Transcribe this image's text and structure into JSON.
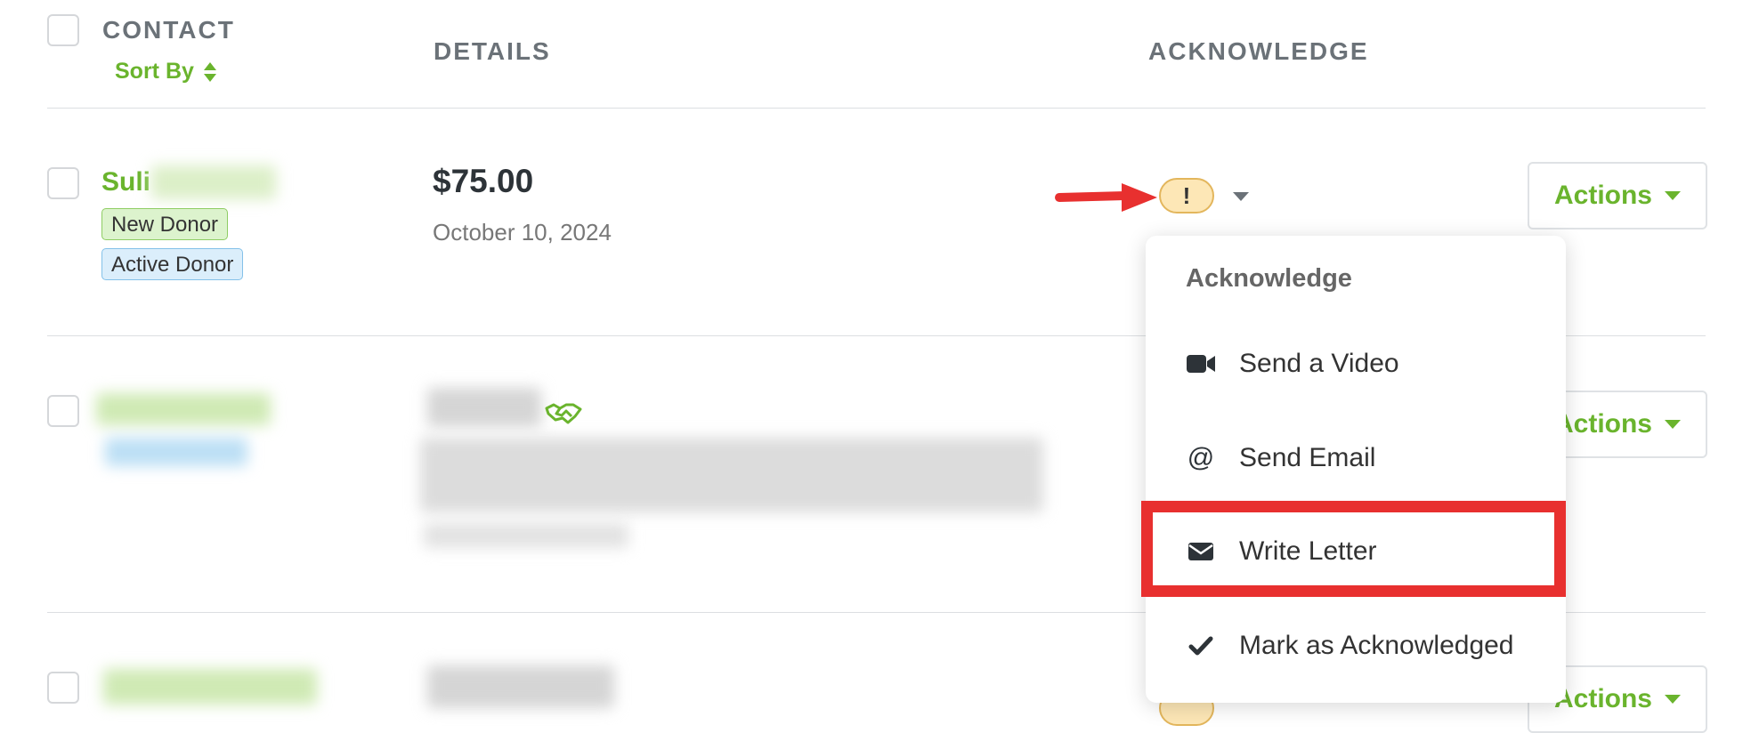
{
  "header": {
    "contact_label": "CONTACT",
    "sort_label": "Sort By",
    "details_label": "DETAILS",
    "acknowledge_label": "ACKNOWLEDGE"
  },
  "rows": [
    {
      "name": "Suli",
      "badges": [
        "New Donor",
        "Active Donor"
      ],
      "amount": "$75.00",
      "date": "October 10, 2024",
      "actions_label": "Actions"
    },
    {
      "actions_label": "Actions"
    },
    {
      "actions_label": "Actions"
    }
  ],
  "dropdown": {
    "title": "Acknowledge",
    "items": [
      {
        "label": "Send a Video",
        "icon": "video-camera-icon"
      },
      {
        "label": "Send Email",
        "icon": "at-sign-icon"
      },
      {
        "label": "Write Letter",
        "icon": "envelope-icon"
      },
      {
        "label": "Mark as Acknowledged",
        "icon": "checkmark-icon"
      }
    ]
  },
  "status": {
    "warning_symbol": "!"
  },
  "colors": {
    "brand_green": "#6ab42d",
    "highlight_red": "#e8302f",
    "warning_bg": "#fde7b6"
  }
}
